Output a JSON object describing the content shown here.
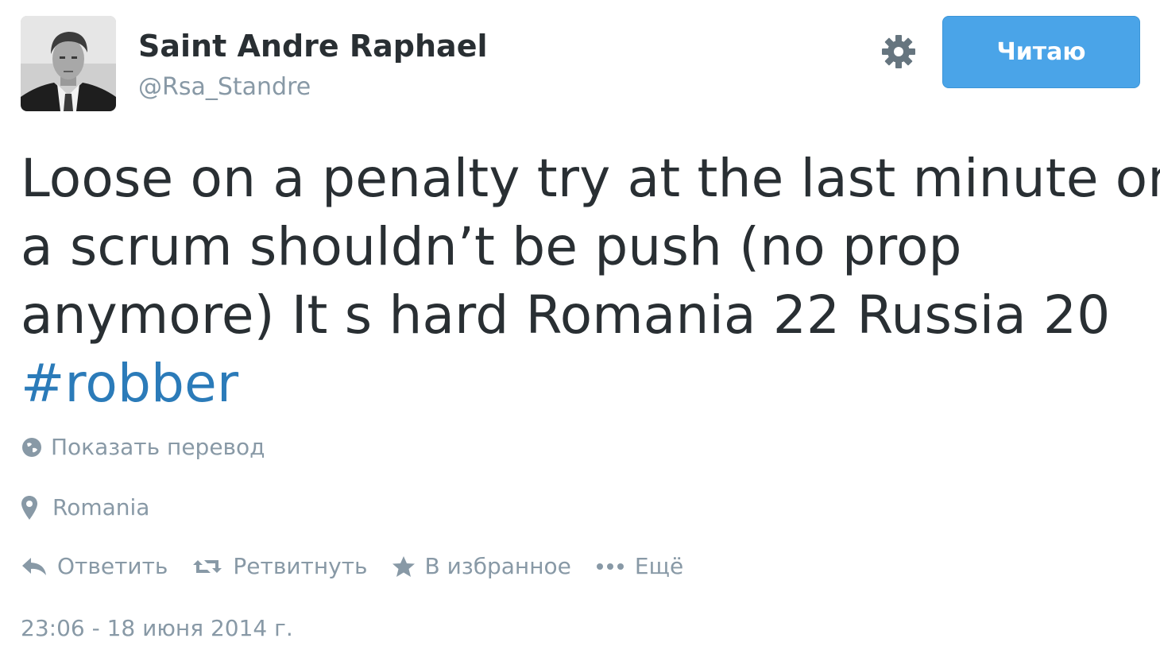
{
  "user": {
    "name": "Saint Andre Raphael",
    "handle": "@Rsa_Standre"
  },
  "follow_button": {
    "label": "Читаю"
  },
  "settings": {
    "icon": "gear-icon"
  },
  "tweet": {
    "text_lines": [
      "Loose on a penalty try at the last minute on",
      "a scrum shouldn’t be push (no prop",
      "anymore) It s hard Romania 22 Russia 20"
    ],
    "hashtag": "#robber"
  },
  "translate": {
    "label": "Показать перевод",
    "icon": "globe-icon"
  },
  "location": {
    "label": "Romania",
    "icon": "map-pin-icon"
  },
  "actions": {
    "reply": {
      "label": "Ответить",
      "icon": "reply-icon"
    },
    "retweet": {
      "label": "Ретвитнуть",
      "icon": "retweet-icon"
    },
    "favorite": {
      "label": "В избранное",
      "icon": "star-icon"
    },
    "more": {
      "label": "Ещё",
      "icon": "more-dots-icon"
    }
  },
  "timestamp": "23:06 - 18 июня 2014 г.",
  "colors": {
    "text": "#292f33",
    "secondary": "#8899a6",
    "link": "#2b7bb9",
    "follow_button": "#4aa4e8"
  }
}
